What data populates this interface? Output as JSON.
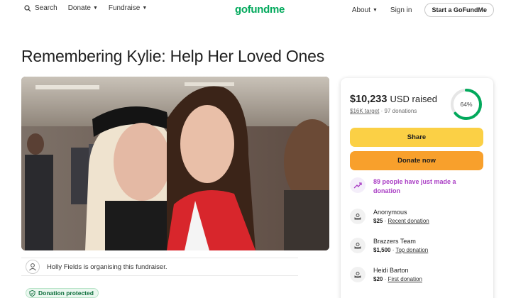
{
  "header": {
    "search_label": "Search",
    "donate_label": "Donate",
    "fundraise_label": "Fundraise",
    "logo": "gofundme",
    "about_label": "About",
    "signin_label": "Sign in",
    "start_label": "Start a GoFundMe"
  },
  "campaign": {
    "title": "Remembering Kylie: Help Her Loved Ones",
    "organizer_text": "Holly Fields is organising this fundraiser.",
    "protected_label": "Donation protected"
  },
  "card": {
    "amount": "$10,233",
    "amount_suffix": "USD raised",
    "target": "$16K target",
    "separator": "·",
    "donations": "97 donations",
    "progress_label": "64%",
    "progress": 0.64,
    "share_label": "Share",
    "donate_label": "Donate now",
    "trend_text": "89 people have just made a donation",
    "donors": [
      {
        "name": "Anonymous",
        "amount": "$25",
        "tag": "Recent donation"
      },
      {
        "name": "Brazzers Team",
        "amount": "$1,500",
        "tag": "Top donation"
      },
      {
        "name": "Heidi Barton",
        "amount": "$20",
        "tag": "First donation"
      }
    ]
  },
  "colors": {
    "brand": "#02a95c",
    "share": "#fbd045",
    "donate": "#f8a02c",
    "trend": "#a93cc4"
  }
}
